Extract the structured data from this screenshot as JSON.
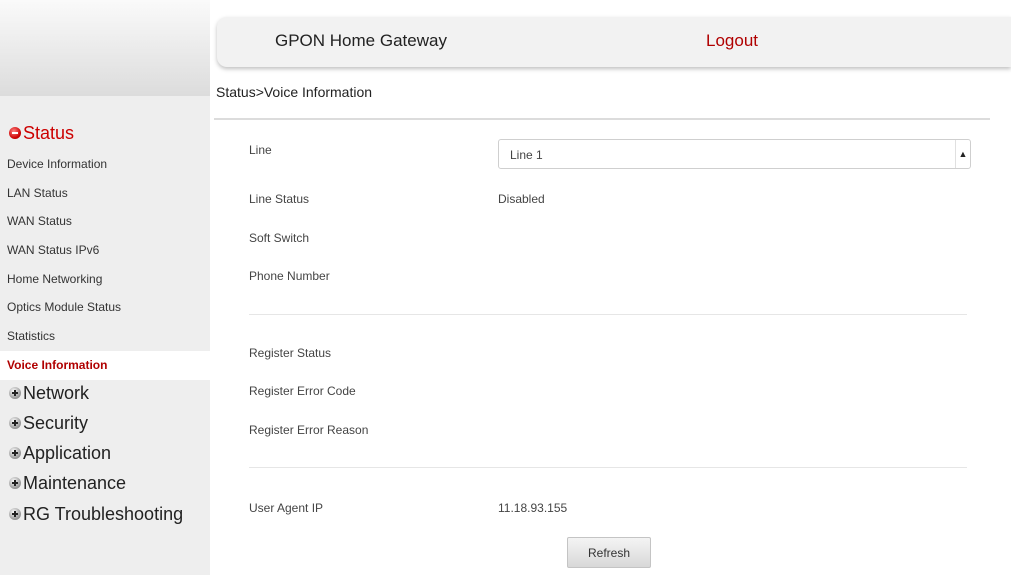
{
  "header": {
    "brand": "GPON Home Gateway",
    "logout": "Logout"
  },
  "breadcrumb": "Status>Voice Information",
  "sidebar": {
    "sections": [
      {
        "label": "Status",
        "state": "expanded"
      },
      {
        "label": "Network",
        "state": "collapsed"
      },
      {
        "label": "Security",
        "state": "collapsed"
      },
      {
        "label": "Application",
        "state": "collapsed"
      },
      {
        "label": "Maintenance",
        "state": "collapsed"
      },
      {
        "label": "RG Troubleshooting",
        "state": "collapsed"
      }
    ],
    "status_items": [
      "Device Information",
      "LAN Status",
      "WAN Status",
      "WAN Status IPv6",
      "Home Networking",
      "Optics Module Status",
      "Statistics",
      "Voice Information"
    ],
    "current_item": "Voice Information"
  },
  "form": {
    "line": {
      "label": "Line",
      "selected": "Line 1"
    },
    "line_status": {
      "label": "Line Status",
      "value": "Disabled"
    },
    "soft_switch": {
      "label": "Soft Switch",
      "value": ""
    },
    "phone_number": {
      "label": "Phone Number",
      "value": ""
    },
    "register_status": {
      "label": "Register Status",
      "value": ""
    },
    "register_error_code": {
      "label": "Register Error Code",
      "value": ""
    },
    "register_error_reason": {
      "label": "Register Error Reason",
      "value": ""
    },
    "user_agent_ip": {
      "label": "User Agent IP",
      "value": "11.18.93.155"
    },
    "refresh_label": "Refresh"
  },
  "icons": {
    "expanded": "minus-circle-icon",
    "collapsed": "plus-circle-icon",
    "select_caret": "dropdown-caret-icon"
  },
  "colors": {
    "accent": "#cc0000",
    "current_item": "#b00000"
  }
}
